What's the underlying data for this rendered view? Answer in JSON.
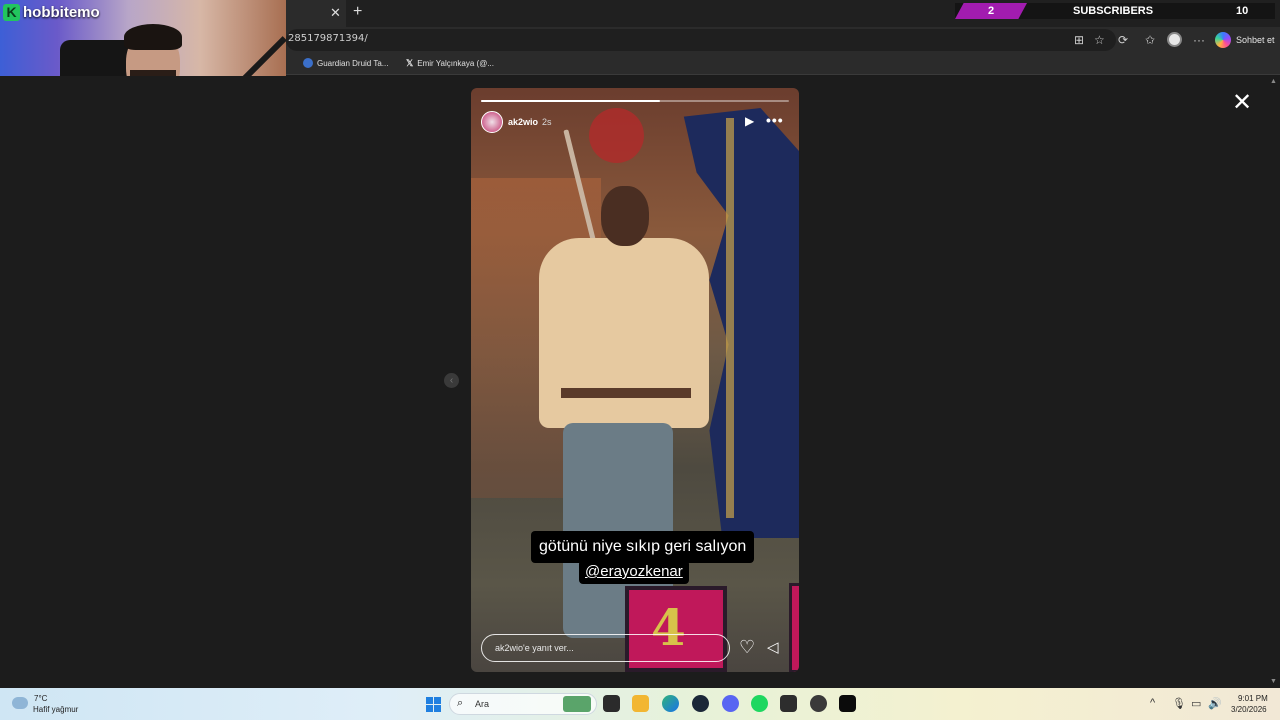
{
  "browser": {
    "url_fragment": "285179871394/",
    "copilot_label": "Sohbet et",
    "bookmarks": [
      {
        "label": "Guardian Druid Ta...",
        "icon": "wowhead-icon"
      },
      {
        "label": "Emir Yalçınkaya (@...",
        "icon": "x-logo-icon"
      }
    ]
  },
  "stream_overlay": {
    "subscriber_count": "2",
    "subscribers_label": "SUBSCRIBERS",
    "subscriber_goal": "10",
    "webcam_name": "hobbitemo",
    "webcam_logo": "K"
  },
  "story": {
    "username": "ak2wio",
    "time_ago": "2s",
    "progress": 0.58,
    "caption": "götünü niye sıkıp geri salıyon",
    "mention": "@erayozkenar",
    "block_number": "4",
    "reply_placeholder": "ak2wio'e yanıt ver..."
  },
  "taskbar": {
    "temperature": "7°C",
    "weather": "Hafif yağmur",
    "search_placeholder": "Ara",
    "time": "9:01 PM",
    "date": "3/20/2026"
  },
  "colors": {
    "subscriber_accent": "#a21caf",
    "kick_green": "#22c55e"
  }
}
